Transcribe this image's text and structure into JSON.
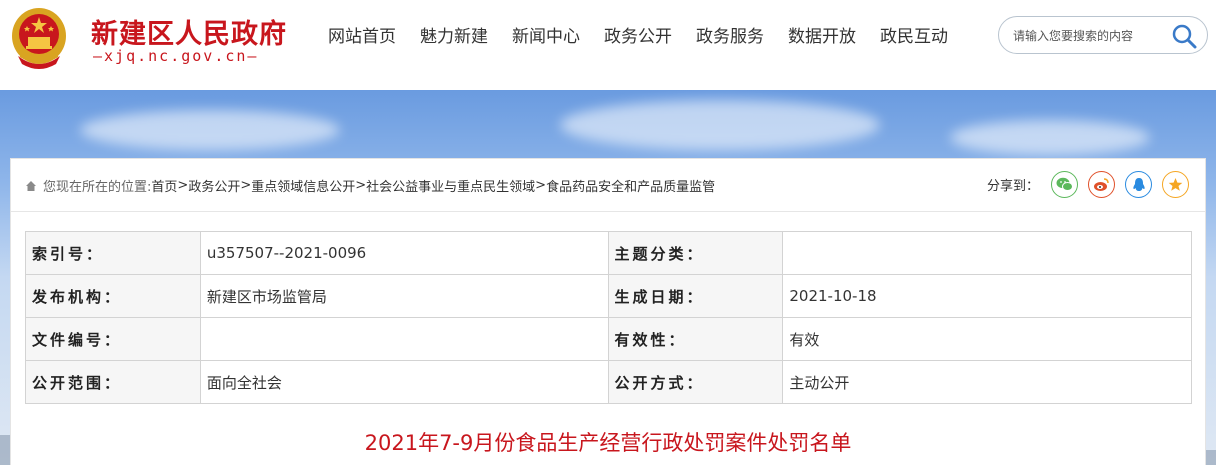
{
  "header": {
    "title": "新建区人民政府",
    "domain": "—xjq.nc.gov.cn—"
  },
  "nav": [
    "网站首页",
    "魅力新建",
    "新闻中心",
    "政务公开",
    "政务服务",
    "数据开放",
    "政民互动"
  ],
  "search": {
    "placeholder": "请输入您要搜索的内容"
  },
  "breadcrumb": {
    "lead": "您现在所在的位置:",
    "items": [
      "首页",
      "政务公开",
      "重点领域信息公开",
      "社会公益事业与重点民生领域",
      "食品药品安全和产品质量监管"
    ],
    "sep": ">"
  },
  "share": {
    "label": "分享到：",
    "buttons": [
      {
        "name": "wechat",
        "color": "#5cb85c"
      },
      {
        "name": "weibo",
        "color": "#e0512a"
      },
      {
        "name": "qq",
        "color": "#2a8be0"
      },
      {
        "name": "qzone",
        "color": "#f5a623"
      }
    ]
  },
  "meta": {
    "rows": [
      [
        {
          "k": "索引号：",
          "v": "u357507--2021-0096"
        },
        {
          "k": "主题分类：",
          "v": ""
        }
      ],
      [
        {
          "k": "发布机构：",
          "v": "新建区市场监管局"
        },
        {
          "k": "生成日期：",
          "v": "2021-10-18"
        }
      ],
      [
        {
          "k": "文件编号：",
          "v": ""
        },
        {
          "k": "有效性：",
          "v": "有效"
        }
      ],
      [
        {
          "k": "公开范围：",
          "v": "面向全社会"
        },
        {
          "k": "公开方式：",
          "v": "主动公开"
        }
      ]
    ]
  },
  "document": {
    "title": "2021年7-9月份食品生产经营行政处罚案件处罚名单"
  },
  "colors": {
    "brand_red": "#c8161d"
  }
}
